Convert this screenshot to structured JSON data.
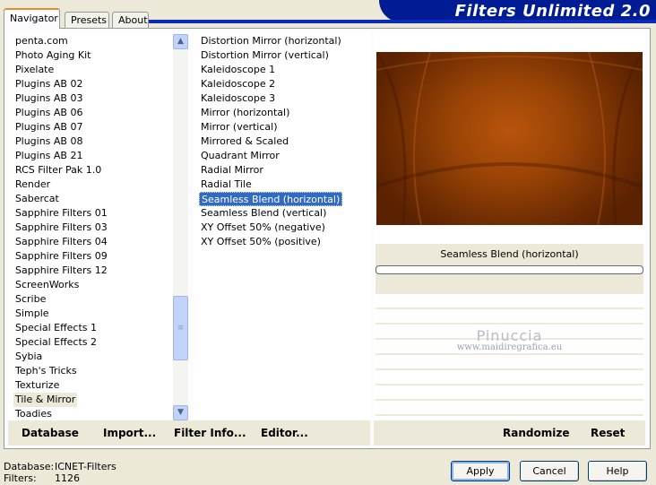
{
  "window": {
    "title": "Filters Unlimited 2.0"
  },
  "tabs": [
    {
      "label": "Navigator"
    },
    {
      "label": "Presets"
    },
    {
      "label": "About"
    }
  ],
  "categories": {
    "items": [
      "penta.com",
      "Photo Aging Kit",
      "Pixelate",
      "Plugins AB 02",
      "Plugins AB 03",
      "Plugins AB 06",
      "Plugins AB 07",
      "Plugins AB 08",
      "Plugins AB 21",
      "RCS Filter Pak 1.0",
      "Render",
      "Sabercat",
      "Sapphire Filters 01",
      "Sapphire Filters 03",
      "Sapphire Filters 04",
      "Sapphire Filters 09",
      "Sapphire Filters 12",
      "ScreenWorks",
      "Scribe",
      "Simple",
      "Special Effects 1",
      "Special Effects 2",
      "Sybia",
      "Teph's Tricks",
      "Texturize",
      "Tile & Mirror",
      "Toadies"
    ],
    "selected": "Tile & Mirror"
  },
  "filters": {
    "items": [
      "Distortion Mirror (horizontal)",
      "Distortion Mirror (vertical)",
      "Kaleidoscope 1",
      "Kaleidoscope 2",
      "Kaleidoscope 3",
      "Mirror (horizontal)",
      "Mirror (vertical)",
      "Mirrored & Scaled",
      "Quadrant Mirror",
      "Radial Mirror",
      "Radial Tile",
      "Seamless Blend (horizontal)",
      "Seamless Blend (vertical)",
      "XY Offset 50% (negative)",
      "XY Offset 50% (positive)"
    ],
    "selected": "Seamless Blend (horizontal)"
  },
  "preview": {
    "filter_name": "Seamless Blend (horizontal)",
    "progress": 0
  },
  "watermark": {
    "line1": "Pinuccia",
    "line2": "www.maidiregrafica.eu"
  },
  "links": {
    "database": "Database",
    "import": "Import...",
    "filter_info": "Filter Info...",
    "editor": "Editor...",
    "randomize": "Randomize",
    "reset": "Reset"
  },
  "status": {
    "database_label": "Database:",
    "database_value": "ICNET-Filters",
    "filters_label": "Filters:",
    "filters_value": "1126"
  },
  "buttons": {
    "apply": "Apply",
    "cancel": "Cancel",
    "help": "Help"
  },
  "colors": {
    "banner": "#001c94",
    "selection": "#316ac5",
    "tab_accent": "#e68b2c"
  }
}
